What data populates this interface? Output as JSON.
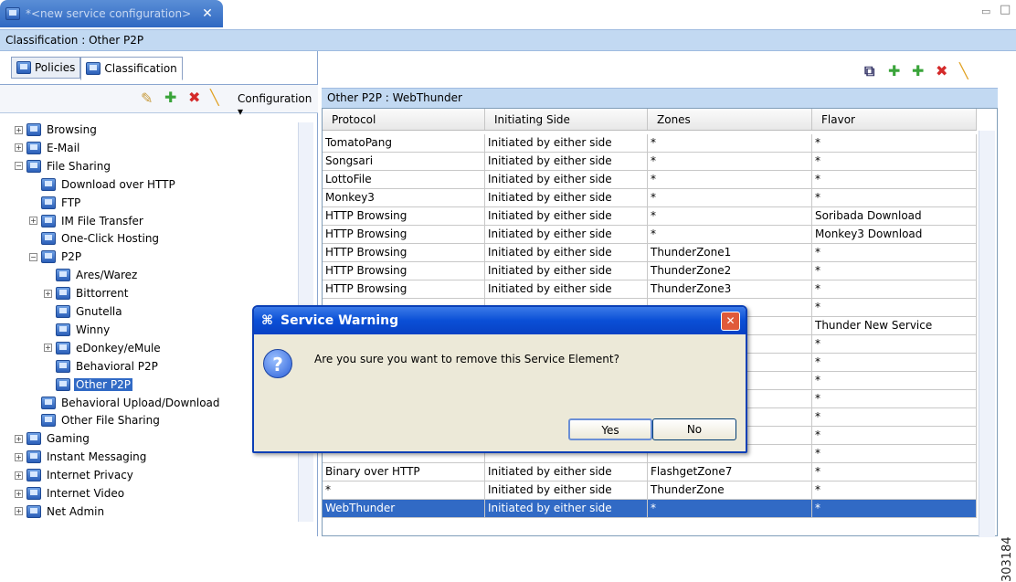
{
  "editor_tab": {
    "title": "*<new service configuration>",
    "close": "✕"
  },
  "window_controls": {
    "minimize": "▭",
    "maximize": "□"
  },
  "header": {
    "title": "Classification : Other P2P"
  },
  "left": {
    "tabs": [
      {
        "label": "Policies"
      },
      {
        "label": "Classification"
      }
    ],
    "toolbar": {
      "configuration_label": "Configuration ▾"
    },
    "tree": [
      {
        "label": "Browsing",
        "exp": "+",
        "level": 0
      },
      {
        "label": "E-Mail",
        "exp": "+",
        "level": 0
      },
      {
        "label": "File Sharing",
        "exp": "−",
        "level": 0
      },
      {
        "label": "Download over HTTP",
        "level": 1
      },
      {
        "label": "FTP",
        "level": 1
      },
      {
        "label": "IM File Transfer",
        "exp": "+",
        "level": 1
      },
      {
        "label": "One-Click Hosting",
        "level": 1
      },
      {
        "label": "P2P",
        "exp": "−",
        "level": 1
      },
      {
        "label": "Ares/Warez",
        "level": 2
      },
      {
        "label": "Bittorrent",
        "exp": "+",
        "level": 2
      },
      {
        "label": "Gnutella",
        "level": 2
      },
      {
        "label": "Winny",
        "level": 2
      },
      {
        "label": "eDonkey/eMule",
        "exp": "+",
        "level": 2
      },
      {
        "label": "Behavioral P2P",
        "level": 2
      },
      {
        "label": "Other P2P",
        "level": 2,
        "selected": true
      },
      {
        "label": "Behavioral Upload/Download",
        "level": 1
      },
      {
        "label": "Other File Sharing",
        "level": 1
      },
      {
        "label": "Gaming",
        "exp": "+",
        "level": 0
      },
      {
        "label": "Instant Messaging",
        "exp": "+",
        "level": 0
      },
      {
        "label": "Internet Privacy",
        "exp": "+",
        "level": 0
      },
      {
        "label": "Internet Video",
        "exp": "+",
        "level": 0
      },
      {
        "label": "Net Admin",
        "exp": "+",
        "level": 0
      }
    ]
  },
  "right": {
    "path": "Other P2P : WebThunder",
    "columns": [
      "Protocol",
      "Initiating Side",
      "Zones",
      "Flavor"
    ],
    "rows": [
      [
        "TomatoPang",
        "Initiated by either side",
        "*",
        "*"
      ],
      [
        "Songsari",
        "Initiated by either side",
        "*",
        "*"
      ],
      [
        "LottoFile",
        "Initiated by either side",
        "*",
        "*"
      ],
      [
        "Monkey3",
        "Initiated by either side",
        "*",
        "*"
      ],
      [
        "HTTP Browsing",
        "Initiated by either side",
        "*",
        "Soribada Download"
      ],
      [
        "HTTP Browsing",
        "Initiated by either side",
        "*",
        "Monkey3 Download"
      ],
      [
        "HTTP Browsing",
        "Initiated by either side",
        "ThunderZone1",
        "*"
      ],
      [
        "HTTP Browsing",
        "Initiated by either side",
        "ThunderZone2",
        "*"
      ],
      [
        "HTTP Browsing",
        "Initiated by either side",
        "ThunderZone3",
        "*"
      ],
      [
        "",
        "",
        "",
        "*"
      ],
      [
        "",
        "",
        "",
        "Thunder New Service"
      ],
      [
        "",
        "",
        "",
        "*"
      ],
      [
        "",
        "",
        "",
        "*"
      ],
      [
        "",
        "",
        "",
        "*"
      ],
      [
        "",
        "",
        "",
        "*"
      ],
      [
        "",
        "",
        "",
        "*"
      ],
      [
        "",
        "",
        "",
        "*"
      ],
      [
        "",
        "",
        "",
        "*"
      ],
      [
        "Binary over HTTP",
        "Initiated by either side",
        "FlashgetZone7",
        "*"
      ],
      [
        "*",
        "Initiated by either side",
        "ThunderZone",
        "*"
      ],
      [
        "WebThunder",
        "Initiated by either side",
        "*",
        "*"
      ]
    ]
  },
  "dialog": {
    "title": "Service Warning",
    "message": "Are you sure you want to remove this Service Element?",
    "yes": "Yes",
    "no": "No",
    "question_glyph": "?",
    "close_glyph": "✕"
  },
  "figure_id": "303184"
}
